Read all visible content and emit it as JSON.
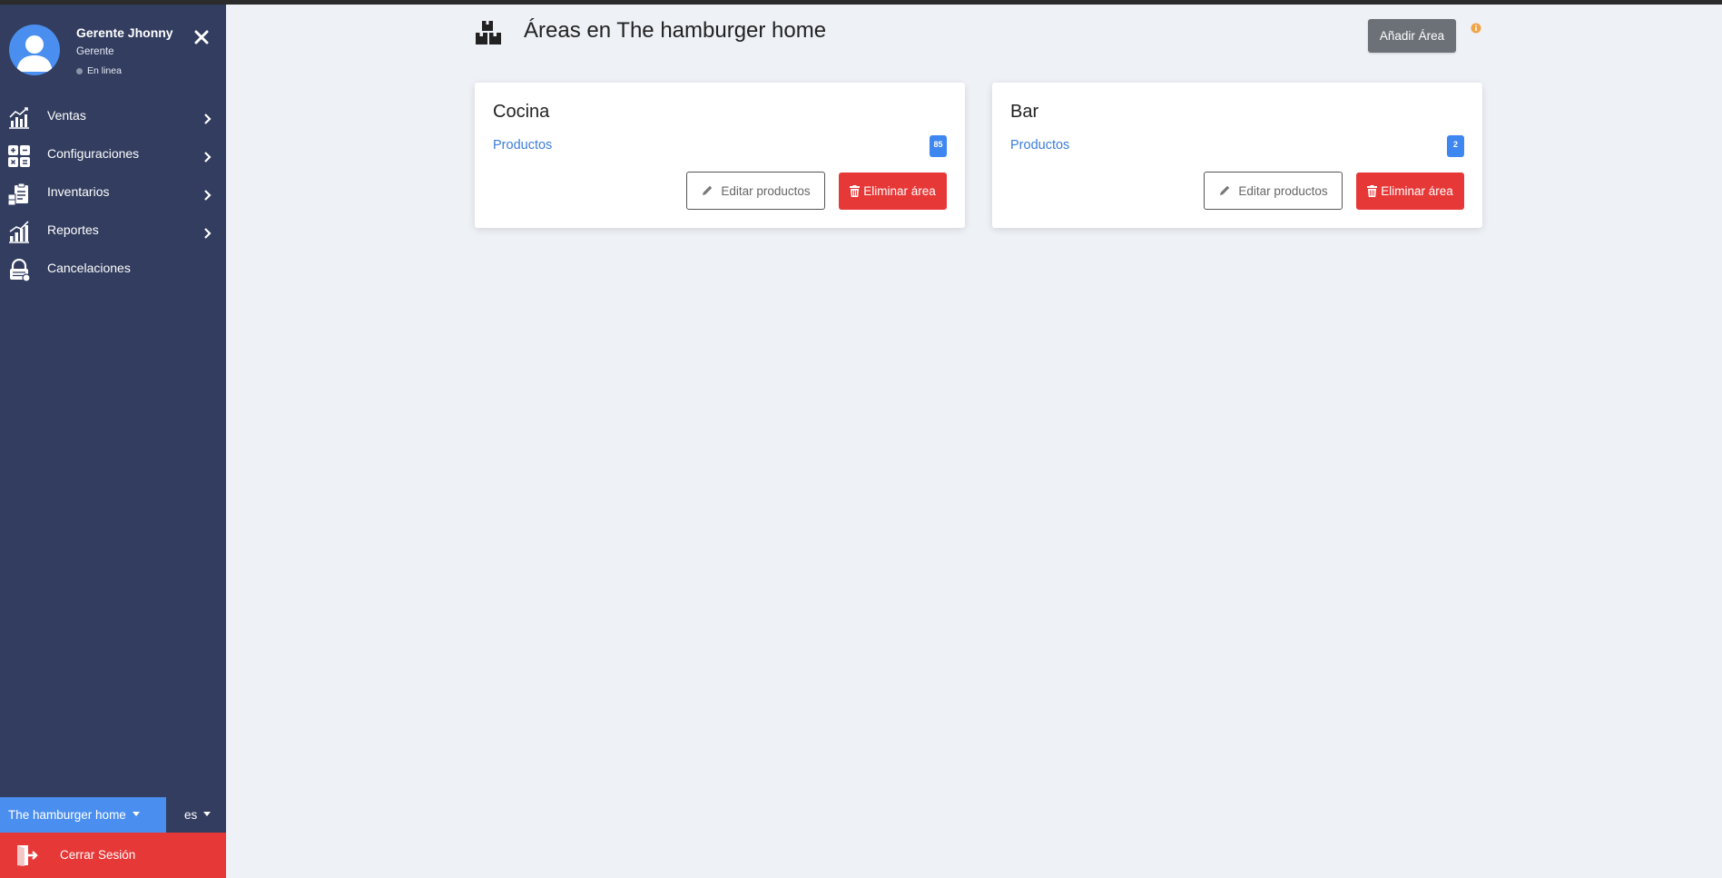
{
  "profile": {
    "name": "Gerente Jhonny",
    "role": "Gerente",
    "status": "En linea"
  },
  "sidebar": {
    "items": [
      {
        "label": "Ventas",
        "icon": "sales-chart-icon",
        "has_submenu": true
      },
      {
        "label": "Configuraciones",
        "icon": "grid-settings-icon",
        "has_submenu": true
      },
      {
        "label": "Inventarios",
        "icon": "inventory-clipboard-icon",
        "has_submenu": true
      },
      {
        "label": "Reportes",
        "icon": "reports-chart-icon",
        "has_submenu": true
      },
      {
        "label": "Cancelaciones",
        "icon": "lock-icon",
        "has_submenu": false
      }
    ],
    "restaurant": "The hamburger home",
    "language": "es",
    "logout_label": "Cerrar Sesión"
  },
  "header": {
    "title": "Áreas en The hamburger home",
    "add_button": "Añadir Área"
  },
  "areas": [
    {
      "name": "Cocina",
      "link_label": "Productos",
      "product_count": "85",
      "edit_label": "Editar productos",
      "delete_label": "Eliminar área"
    },
    {
      "name": "Bar",
      "link_label": "Productos",
      "product_count": "2",
      "edit_label": "Editar productos",
      "delete_label": "Eliminar área"
    }
  ],
  "colors": {
    "sidebar_bg": "#323d5f",
    "page_bg": "#eef1f6",
    "accent_blue": "#4a8ff0",
    "danger_red": "#e73838",
    "secondary_gray": "#6c7178",
    "link_blue": "#3d7ddb",
    "info_orange": "#f0a445"
  }
}
